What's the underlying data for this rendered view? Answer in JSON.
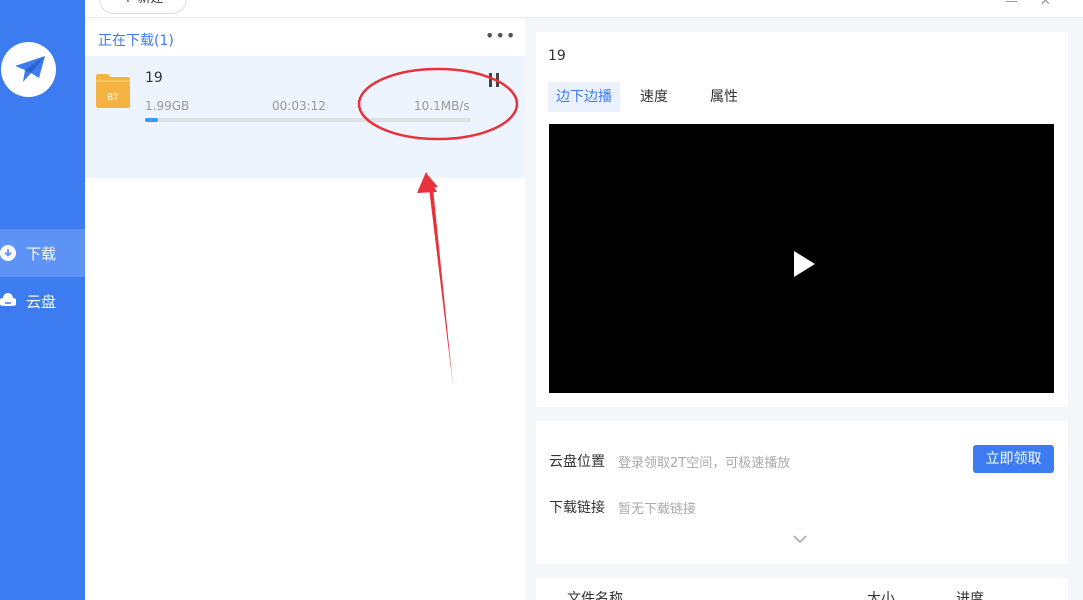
{
  "toolbar": {
    "new_label": "+ 新建",
    "minimize_glyph": "—",
    "close_glyph": "✕"
  },
  "sidebar": {
    "logo_icon": "bird-logo-icon",
    "items": [
      {
        "label": "下载",
        "icon": "download-icon",
        "active": true
      },
      {
        "label": "云盘",
        "icon": "cloud-icon",
        "active": false
      }
    ]
  },
  "downloads": {
    "section_title": "正在下载(1)",
    "more_label": "•••",
    "tasks": [
      {
        "name": "19",
        "type_badge": "BT",
        "size": "1.99GB",
        "time": "00:03:12",
        "speed": "10.1MB/s",
        "progress": 0.04
      }
    ]
  },
  "detail": {
    "title": "19",
    "tabs": [
      {
        "label": "边下边播",
        "active": true
      },
      {
        "label": "速度",
        "active": false
      },
      {
        "label": "属性",
        "active": false
      }
    ]
  },
  "cloud": {
    "location_label": "云盘位置",
    "location_value": "登录领取2T空间，可极速播放",
    "claim_button": "立即领取",
    "link_label": "下载链接",
    "link_value": "暂无下载链接"
  },
  "files": {
    "columns": [
      "文件名称",
      "大小",
      "进度"
    ]
  },
  "colors": {
    "accent": "#3d7cf0",
    "annotation": "#e8313a",
    "folder": "#f5b342"
  }
}
